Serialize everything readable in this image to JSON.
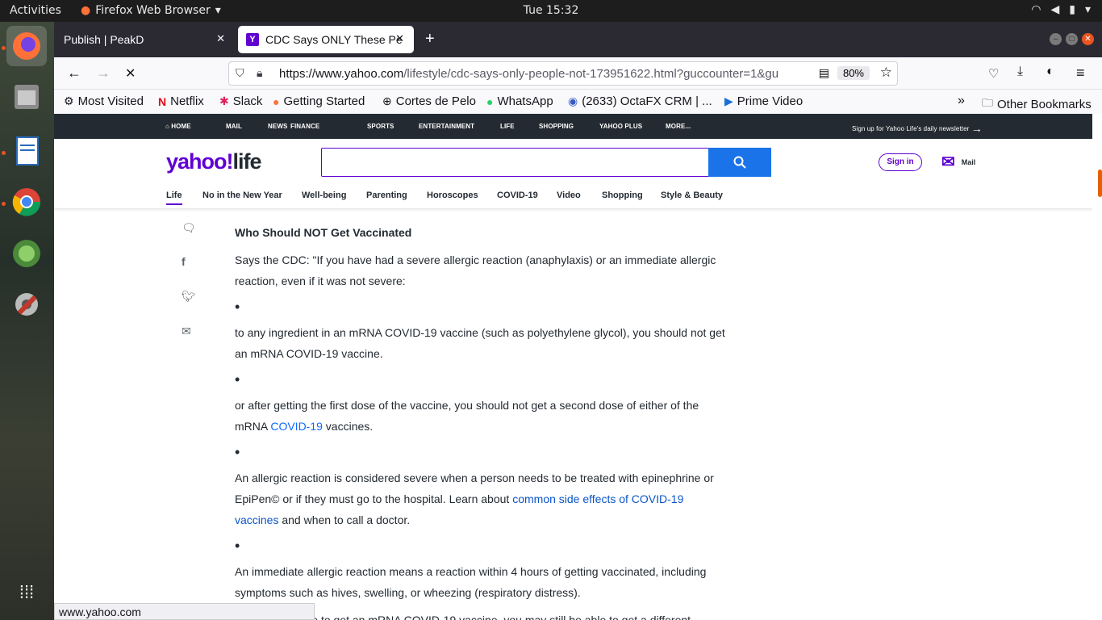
{
  "system": {
    "activities": "Activities",
    "app_name": "Firefox Web Browser",
    "clock": "Tue 15:32"
  },
  "tabs": [
    {
      "title": "Publish | PeakD"
    },
    {
      "title": "CDC Says ONLY These Pe"
    }
  ],
  "url": {
    "domain": "https://www.yahoo.com",
    "path": "/lifestyle/cdc-says-only-people-not-173951622.html?guccounter=1&gu",
    "zoom": "80%"
  },
  "bookmarks": [
    "Most Visited",
    "Netflix",
    "Slack",
    "Getting Started",
    "Cortes de Pelo",
    "WhatsApp",
    "(2633) OctaFX CRM | ...",
    "Prime Video"
  ],
  "other_bookmarks": "Other Bookmarks",
  "yahoo_nav": [
    "HOME",
    "MAIL",
    "NEWS",
    "FINANCE",
    "SPORTS",
    "ENTERTAINMENT",
    "LIFE",
    "SHOPPING",
    "YAHOO PLUS",
    "MORE..."
  ],
  "newsletter": "Sign up for Yahoo Life's daily newsletter",
  "logo": {
    "a": "yahoo!",
    "b": "life"
  },
  "sign_in": "Sign in",
  "mail": "Mail",
  "subnav": [
    "Life",
    "No in the New Year",
    "Well-being",
    "Parenting",
    "Horoscopes",
    "COVID-19",
    "Video",
    "Shopping",
    "Style & Beauty"
  ],
  "article": {
    "heading": "Who Should NOT Get Vaccinated",
    "p1": "Says the CDC: \"If you have had a severe allergic reaction (anaphylaxis) or an immediate allergic reaction, even if it was not severe:",
    "p2": "to any ingredient in an mRNA COVID-19 vaccine (such as polyethylene glycol), you should not get an mRNA COVID-19 vaccine.",
    "p3a": "or after getting the first dose of the vaccine, you should not get a second dose of either of the mRNA ",
    "p3link": "COVID-19",
    "p3b": " vaccines.",
    "p4a": "An allergic reaction is considered severe when a person needs to be treated with epinephrine or EpiPen© or if they must go to the hospital. Learn about ",
    "p4link": "common side effects of COVID-19 vaccines",
    "p4b": " and when to call a doctor.",
    "p5": "An immediate allergic reaction means a reaction within 4 hours of getting vaccinated, including symptoms such as hives, swelling, or wheezing (respiratory distress).",
    "p6": "If you aren't able to get an mRNA COVID-19 vaccine, you may still be able to get a different"
  },
  "status": "www.yahoo.com"
}
